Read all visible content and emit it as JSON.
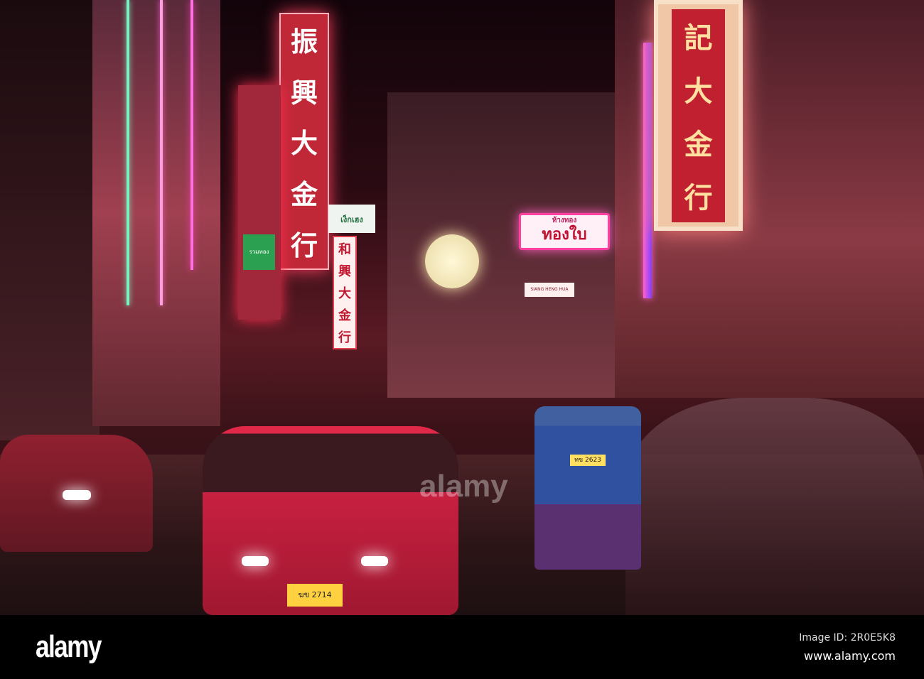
{
  "signs": {
    "left_vertical": [
      "振",
      "興",
      "大",
      "金",
      "行"
    ],
    "center_vertical": [
      "和",
      "興",
      "大",
      "金",
      "行"
    ],
    "right_vertical": [
      "記",
      "大",
      "金",
      "行"
    ],
    "thai_sign_top": "ห้างทอง",
    "thai_sign_main": "ทองใบ",
    "white_sign": "เง็กเฮง",
    "green_sign": "รวมทอง",
    "siang_heng": "SIANG HENG HUA"
  },
  "watermark": {
    "center": "alamy"
  },
  "footer": {
    "logo": "alamy",
    "image_id": "Image ID: 2R0E5K8",
    "website": "www.alamy.com"
  },
  "plates": {
    "taxi": "ฆข 2714",
    "tuktuk": "ทข 2623"
  }
}
